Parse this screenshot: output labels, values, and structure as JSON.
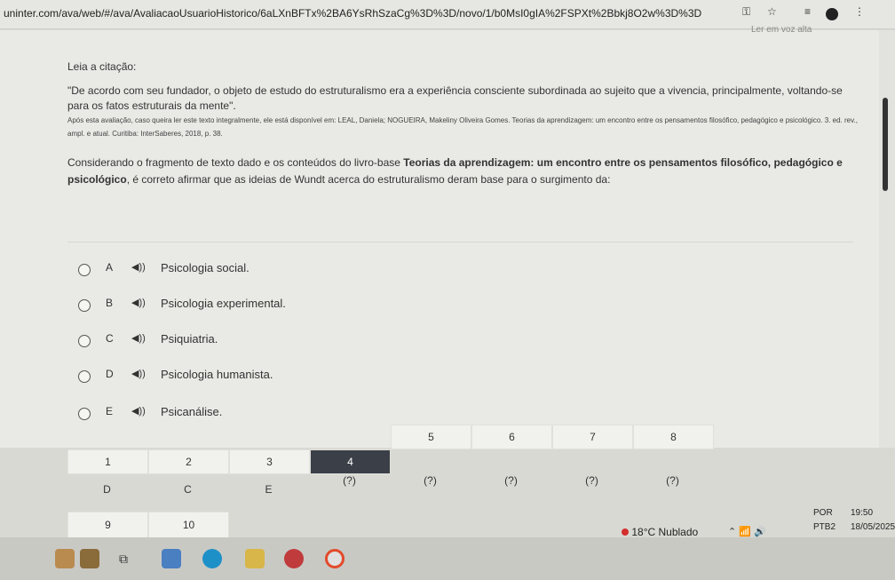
{
  "browser": {
    "url": "uninter.com/ava/web/#/ava/AvaliacaoUsuarioHistorico/6aLXnBFTx%2BA6YsRhSzaCg%3D%3D/novo/1/b0MsI0gIA%2FSPXt%2Bbkj8O2w%3D%3D",
    "read_aloud": "Ler em voz alta"
  },
  "question": {
    "intro_label": "Leia a citação:",
    "quote": "\"De acordo com seu fundador, o objeto de estudo do estruturalismo era a experiência consciente subordinada ao sujeito que a vivencia, principalmente, voltando-se para os fatos estruturais da mente\".",
    "citation": "Após esta avaliação, caso queira ler este texto integralmente, ele está disponível em: LEAL, Daniela; NOGUEIRA, Makeliny Oliveira Gomes. Teorias da aprendizagem: um encontro entre os pensamentos filosófico, pedagógico e psicológico. 3. ed. rev., ampl. e atual. Curitiba: InterSaberes, 2018, p. 38.",
    "prompt_start": "Considerando o fragmento de texto dado e os conteúdos do livro-base ",
    "prompt_bold": "Teorias da aprendizagem: um encontro entre os pensamentos filosófico, pedagógico e psicológico",
    "prompt_end": ", é correto afirmar que as ideias de Wundt acerca do estruturalismo deram base para o surgimento da:"
  },
  "options": [
    {
      "letter": "A",
      "text": "Psicologia social."
    },
    {
      "letter": "B",
      "text": "Psicologia experimental."
    },
    {
      "letter": "C",
      "text": "Psiquiatria."
    },
    {
      "letter": "D",
      "text": "Psicologia humanista."
    },
    {
      "letter": "E",
      "text": "Psicanálise."
    }
  ],
  "navigator": {
    "row1": [
      "1",
      "2",
      "3",
      "4",
      "5",
      "6",
      "7",
      "8"
    ],
    "row2": [
      "D",
      "C",
      "E",
      "(?)",
      "(?)",
      "(?)",
      "(?)",
      "(?)"
    ],
    "row3": [
      "9",
      "10"
    ]
  },
  "taskbar": {
    "temperature": "18°C",
    "weather": "Nublado",
    "lang1": "POR",
    "lang2": "PTB2",
    "time": "19:50",
    "date": "18/05/2025"
  }
}
